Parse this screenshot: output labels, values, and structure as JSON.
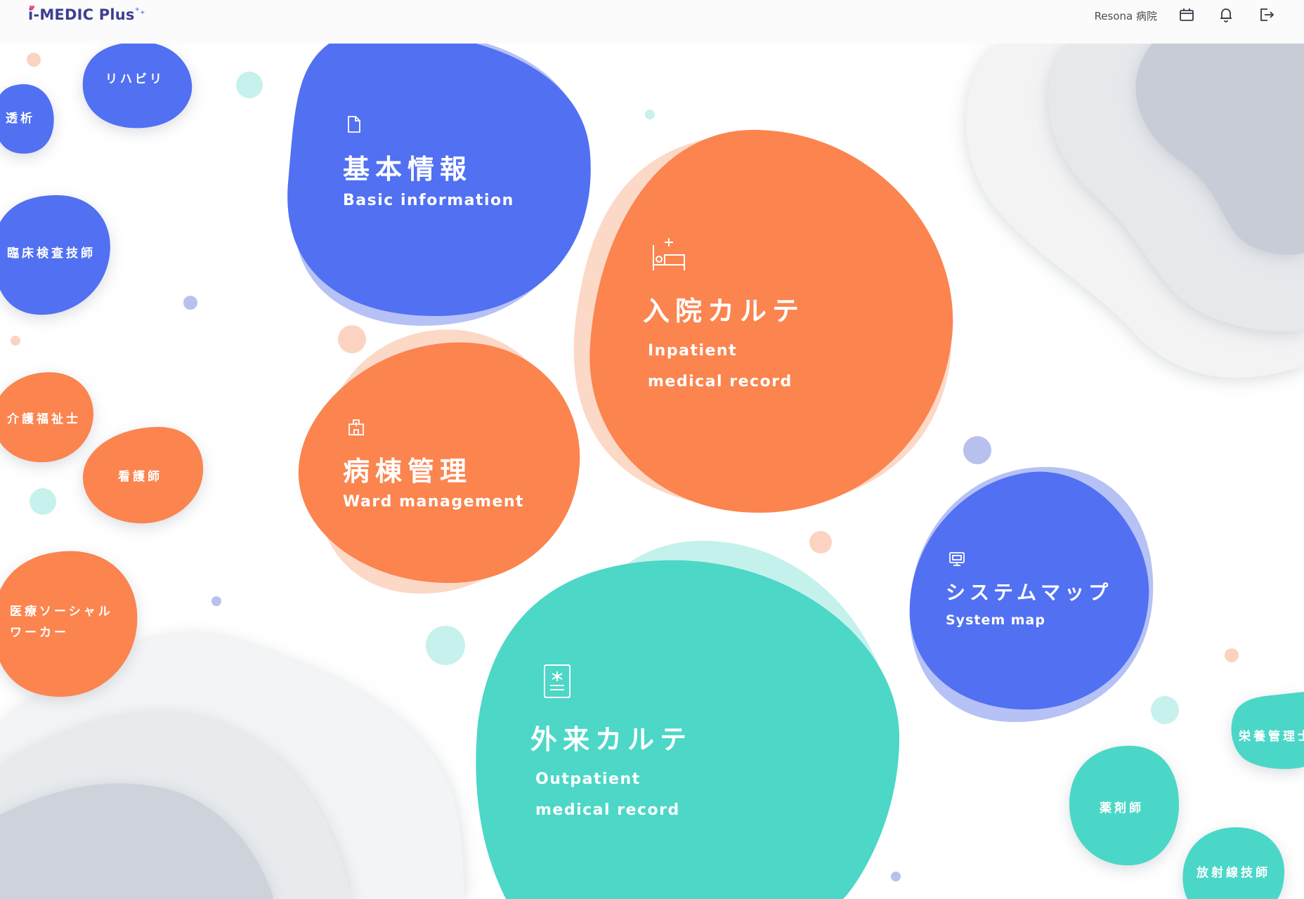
{
  "header": {
    "logo_text": "i-MEDIC Plus",
    "logo_heart": "♥",
    "logo_plus": "⁺₊",
    "hospital_name": "Resona 病院",
    "icons": [
      "calendar-icon",
      "bell-icon",
      "logout-icon"
    ]
  },
  "main_tiles": {
    "basic": {
      "jp": "基本情報",
      "en": "Basic information",
      "icon": "document-icon",
      "color": "#5170f2"
    },
    "inpatient": {
      "jp": "入院カルテ",
      "en1": "Inpatient",
      "en2": "medical record",
      "icon": "bed-icon",
      "color": "#fb844f"
    },
    "ward": {
      "jp": "病棟管理",
      "en": "Ward management",
      "icon": "hospital-building-icon",
      "color": "#fb844f"
    },
    "outpatient": {
      "jp": "外来カルテ",
      "en1": "Outpatient",
      "en2": "medical record",
      "icon": "clipboard-chart-icon",
      "color": "#4cd7c7"
    },
    "systemmap": {
      "jp": "システムマップ",
      "en": "System map",
      "icon": "monitor-icon",
      "color": "#5170f2"
    }
  },
  "role_tiles": {
    "rehab": "リハビリ",
    "dialysis": "透析",
    "lab": "臨床検査技師",
    "careworker": "介護福祉士",
    "nurse": "看護師",
    "social_line1": "医療ソーシャル",
    "social_line2": "ワーカー",
    "nutrition": "栄養管理士",
    "pharmacist": "薬剤師",
    "radiology": "放射線技師"
  },
  "colors": {
    "blue": "#5170f2",
    "orange": "#fb844f",
    "teal": "#4cd7c7",
    "blue_shadow": "#b6c1f5",
    "orange_shadow": "#fcd8c7",
    "teal_shadow": "#c5f1ec",
    "header_bg": "#fbfbfb",
    "logo": "#3d3f8f"
  }
}
